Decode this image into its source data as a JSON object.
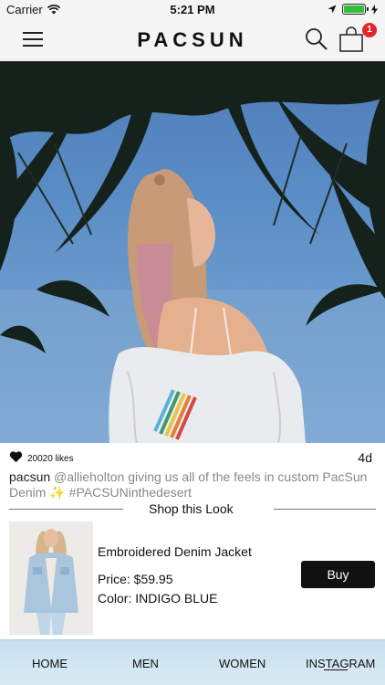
{
  "status_bar": {
    "carrier": "Carrier",
    "time": "5:21 PM"
  },
  "header": {
    "logo": "PACSUN",
    "cart_count": "1"
  },
  "post": {
    "likes": "20020 likes",
    "age": "4d",
    "username": "pacsun",
    "caption": "@allieholton giving us all of the feels in custom PacSun Denim ✨ #PACSUNinthedesert"
  },
  "shop": {
    "title": "Shop this Look",
    "product": {
      "name": "Embroidered Denim Jacket",
      "price": "Price: $59.95",
      "color": "Color: INDIGO BLUE",
      "buy_label": "Buy"
    }
  },
  "bottom_nav": {
    "items": [
      "HOME",
      "MEN",
      "WOMEN",
      "INSTAGRAM"
    ],
    "active": "INSTAGRAM"
  },
  "colors": {
    "badge": "#e4252a",
    "battery": "#2fbf3a",
    "nav_bg": "#d2e5f1",
    "buy_button": "#111111"
  }
}
